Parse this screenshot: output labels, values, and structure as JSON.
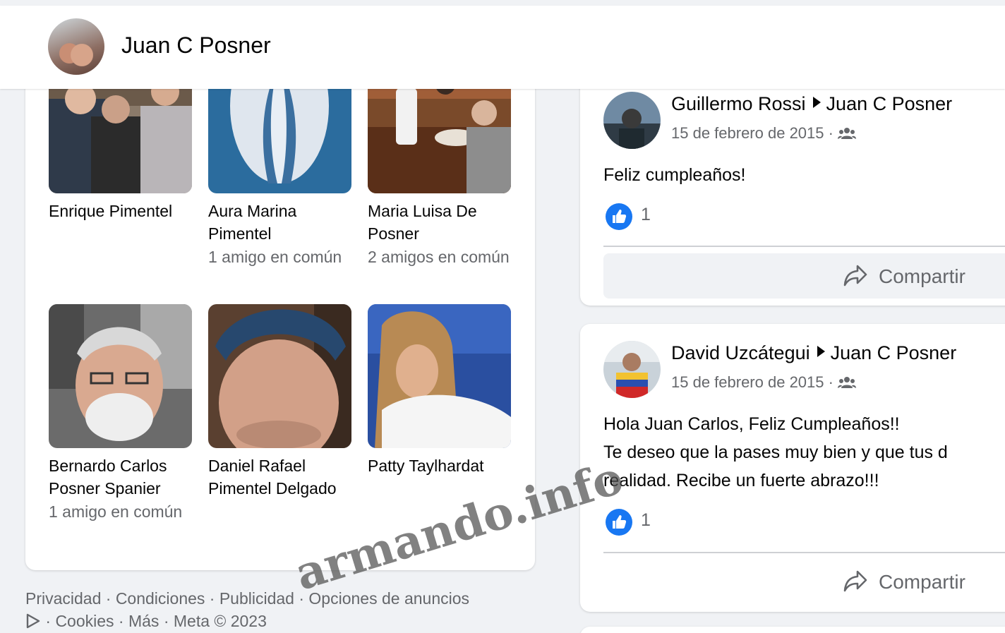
{
  "header": {
    "title": "Juan C Posner"
  },
  "friends": [
    {
      "name": "Enrique Pimentel",
      "mutual": ""
    },
    {
      "name": "Aura Marina Pimentel",
      "mutual": "1 amigo en común"
    },
    {
      "name": "Maria Luisa De Posner",
      "mutual": "2 amigos en común"
    },
    {
      "name": "Bernardo Carlos Posner Spanier",
      "mutual": "1 amigo en común"
    },
    {
      "name": "Daniel Rafael Pimentel Delgado",
      "mutual": ""
    },
    {
      "name": "Patty Taylhardat",
      "mutual": ""
    }
  ],
  "footer": {
    "line1": "Privacidad · Condiciones · Publicidad · Opciones de anuncios",
    "line2": " · Cookies · Más · Meta © 2023"
  },
  "posts": [
    {
      "author": "Guillermo Rossi",
      "target": "Juan C Posner",
      "date": "15 de febrero de 2015 · ",
      "text": [
        "Feliz cumpleaños!"
      ],
      "likes": "1",
      "share_label": "Compartir"
    },
    {
      "author": "David Uzcátegui",
      "target": "Juan C Posner",
      "date": "15 de febrero de 2015 · ",
      "text": [
        "Hola Juan Carlos, Feliz Cumpleaños!!",
        "Te deseo que la pases muy bien y que tus d",
        "realidad. Recibe un fuerte abrazo!!!"
      ],
      "likes": "1",
      "share_label": "Compartir"
    }
  ],
  "watermark": "armando.info",
  "colors": {
    "accent": "#1877f2",
    "secondary_text": "#65676b",
    "background": "#f0f2f5"
  }
}
